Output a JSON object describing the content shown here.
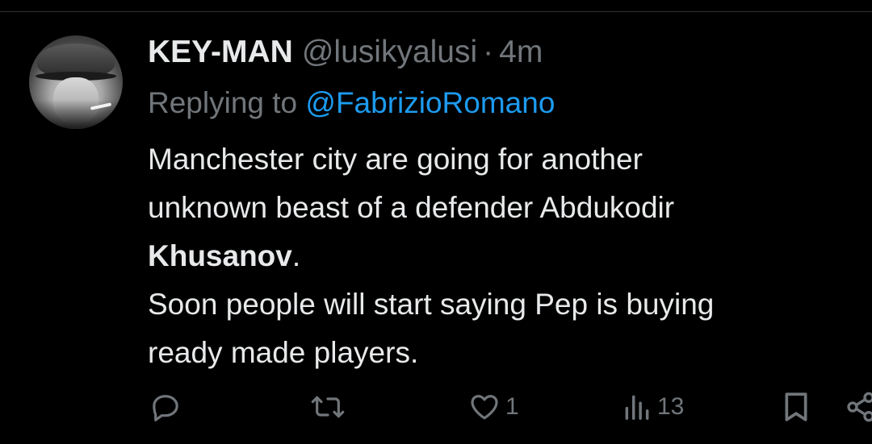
{
  "tweet": {
    "display_name": "KEY-MAN",
    "handle": "@lusikyalusi",
    "separator": "·",
    "time": "4m",
    "replying_prefix": "Replying to",
    "replying_to": "@FabrizioRomano",
    "body": {
      "line1": "Manchester city are going for another",
      "line2": "unknown beast of a defender Abdukodir",
      "line3_bold": "Khusanov",
      "line3_rest": ".",
      "line4": "Soon people will start saying Pep is buying",
      "line5": "ready made players."
    }
  },
  "actions": {
    "reply": {
      "icon": "reply-icon",
      "count": ""
    },
    "retweet": {
      "icon": "retweet-icon",
      "count": ""
    },
    "like": {
      "icon": "heart-icon",
      "count": "1"
    },
    "views": {
      "icon": "views-icon",
      "count": "13"
    },
    "bookmark": {
      "icon": "bookmark-icon"
    },
    "share": {
      "icon": "share-icon"
    }
  },
  "colors": {
    "background": "#000000",
    "text": "#e7e9ea",
    "secondary": "#71767b",
    "link": "#1d9bf0"
  }
}
